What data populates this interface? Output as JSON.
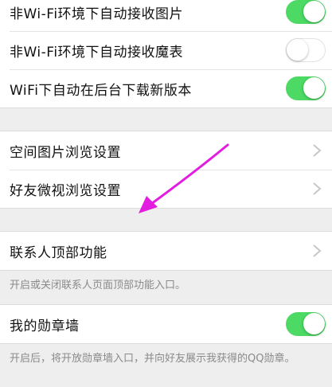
{
  "network": {
    "items": [
      {
        "label": "非Wi-Fi环境下自动接收图片",
        "toggle": "on"
      },
      {
        "label": "非Wi-Fi环境下自动接收魔表",
        "toggle": "off"
      },
      {
        "label": "WiFi下自动在后台下载新版本",
        "toggle": "on"
      }
    ]
  },
  "browse": {
    "items": [
      {
        "label": "空间图片浏览设置"
      },
      {
        "label": "好友微视浏览设置"
      }
    ]
  },
  "contact_top": {
    "label": "联系人顶部功能",
    "hint": "开启或关闭联系人页面顶部功能入口。"
  },
  "medal_wall": {
    "label": "我的勋章墙",
    "toggle": "on",
    "hint": "开启后，将开放勋章墙入口，并向好友展示我获得的QQ勋章。"
  },
  "colors": {
    "toggle_on": "#4cd964",
    "arrow": "#e31de0",
    "background": "#eeeeee"
  },
  "icons": [
    "chevron-right-icon",
    "annotation-arrow"
  ]
}
